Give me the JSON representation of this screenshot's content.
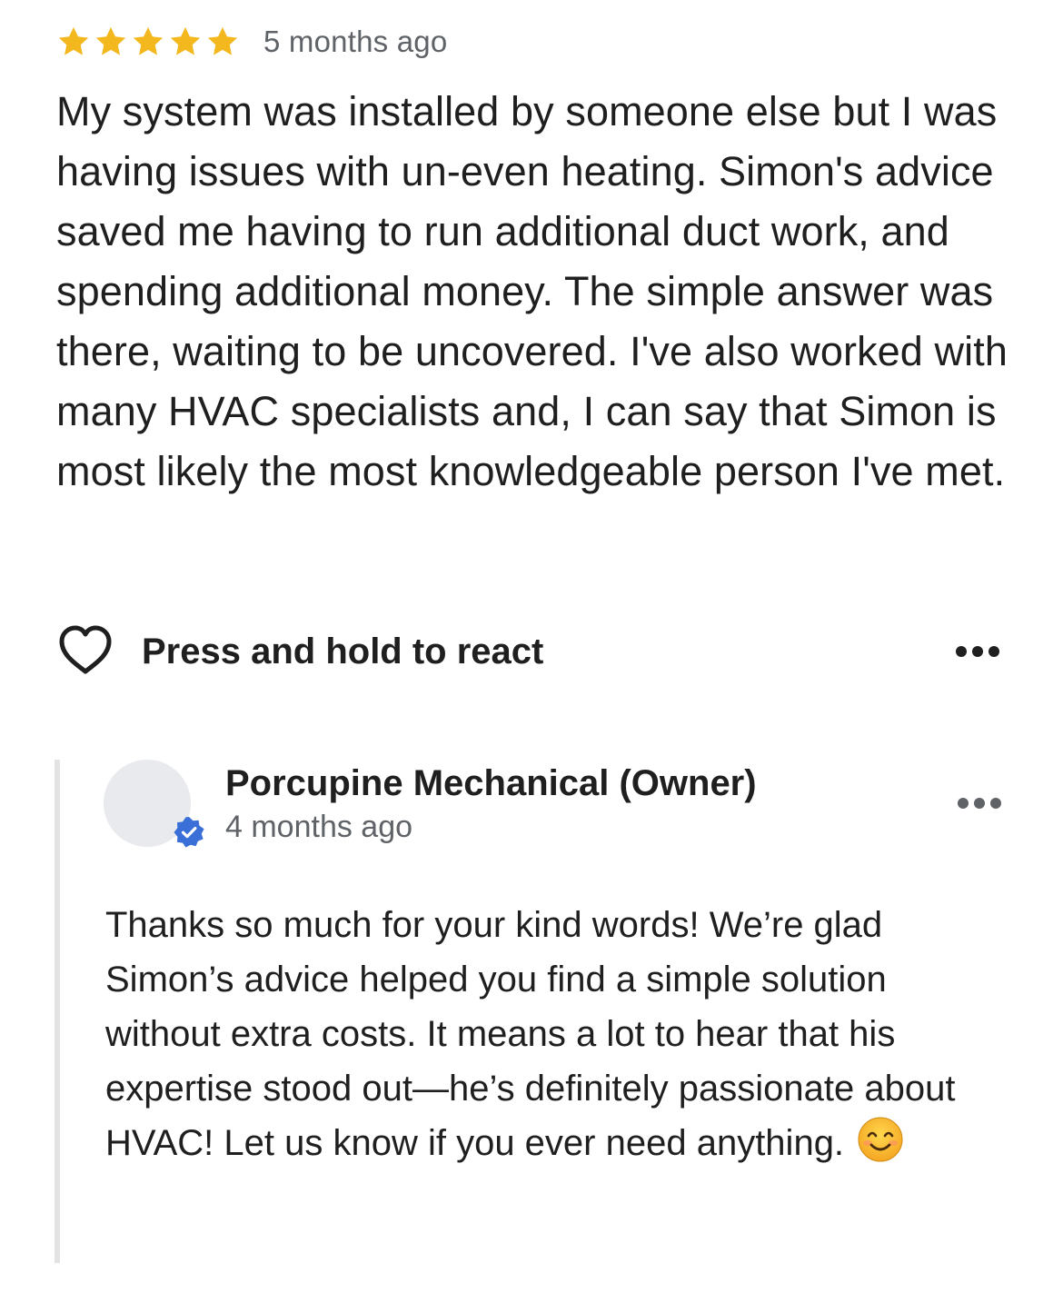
{
  "review": {
    "rating": 5,
    "rating_max": 5,
    "star_color": "#f4b81f",
    "time_ago": "5 months ago",
    "text": "My system was installed by someone else but I was having issues with un-even heating. Simon's advice saved me having to run additional duct work, and spending additional money. The simple answer was there, waiting to be uncovered. I've also worked with many HVAC specialists and, I can say that Simon is most likely the most knowledgeable person I've met."
  },
  "reactions": {
    "label": "Press and hold to react",
    "icon": "heart-outline-icon",
    "more_icon": "more-horizontal-icon"
  },
  "owner_reply": {
    "name": "Porcupine Mechanical (Owner)",
    "time_ago": "4 months ago",
    "verified_icon": "verified-badge-icon",
    "verified_color": "#3b6fd8",
    "text": "Thanks so much for your kind words! We’re glad Simon’s advice helped you find a simple solution without extra costs. It means a lot to hear that his expertise stood out—he’s definitely passionate about HVAC! Let us know if you ever need anything.",
    "emoji": "smiling-face-emoji"
  }
}
